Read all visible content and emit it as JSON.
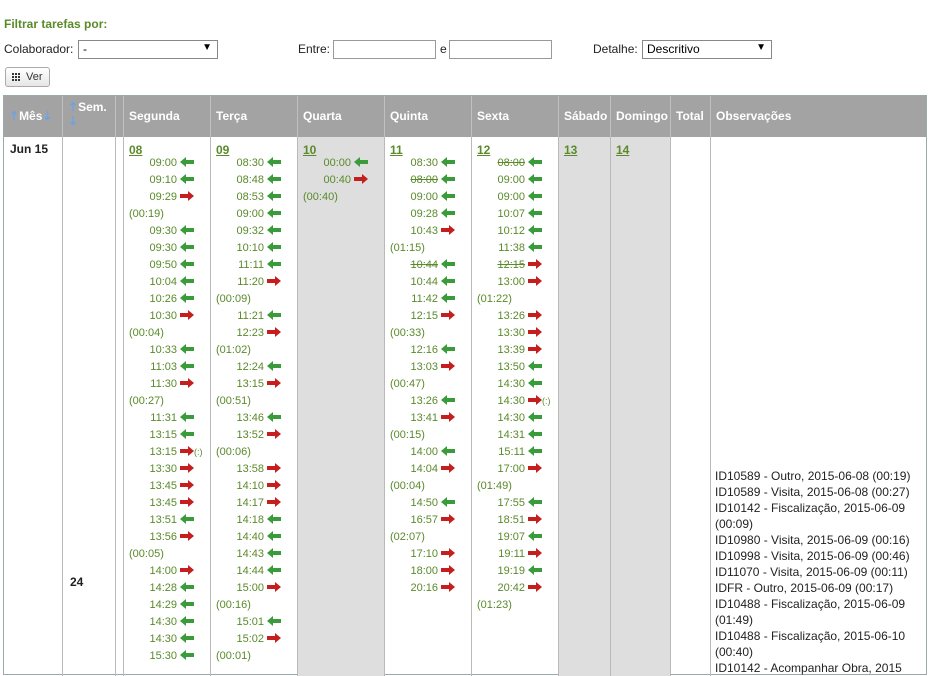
{
  "filter": {
    "title": "Filtrar tarefas por:",
    "colaborador_label": "Colaborador:",
    "colaborador_value": "-",
    "entre_label": "Entre:",
    "e_label": "e",
    "entre_from": "",
    "entre_to": "",
    "detalhe_label": "Detalhe:",
    "detalhe_value": "Descritivo",
    "ver_label": "Ver"
  },
  "table": {
    "headers": {
      "mes": "Mês",
      "sem": "Sem.",
      "seg": "Segunda",
      "ter": "Terça",
      "qua": "Quarta",
      "qui": "Quinta",
      "sex": "Sexta",
      "sab": "Sábado",
      "dom": "Domingo",
      "total": "Total",
      "obs": "Observações"
    },
    "month": "Jun 15",
    "week": "24",
    "days": [
      "08",
      "09",
      "10",
      "11",
      "12",
      "13",
      "14"
    ],
    "segunda": [
      {
        "t": "09:00",
        "d": "in"
      },
      {
        "t": "09:10",
        "d": "in"
      },
      {
        "t": "09:29",
        "d": "out"
      },
      {
        "dur": "(00:19)"
      },
      {
        "t": "09:30",
        "d": "in"
      },
      {
        "t": "09:30",
        "d": "in"
      },
      {
        "t": "09:50",
        "d": "in"
      },
      {
        "t": "10:04",
        "d": "in"
      },
      {
        "t": "10:26",
        "d": "in"
      },
      {
        "t": "10:30",
        "d": "out"
      },
      {
        "dur": "(00:04)"
      },
      {
        "t": "10:33",
        "d": "in"
      },
      {
        "t": "11:03",
        "d": "in"
      },
      {
        "t": "11:30",
        "d": "out"
      },
      {
        "dur": "(00:27)"
      },
      {
        "t": "11:31",
        "d": "in"
      },
      {
        "t": "13:15",
        "d": "in"
      },
      {
        "t": "13:15",
        "d": "out",
        "x": "(:)"
      },
      {
        "t": "13:30",
        "d": "out"
      },
      {
        "t": "13:45",
        "d": "out"
      },
      {
        "t": "13:45",
        "d": "out"
      },
      {
        "t": "13:51",
        "d": "in"
      },
      {
        "t": "13:56",
        "d": "out"
      },
      {
        "dur": "(00:05)"
      },
      {
        "t": "14:00",
        "d": "out"
      },
      {
        "t": "14:28",
        "d": "in"
      },
      {
        "t": "14:29",
        "d": "in"
      },
      {
        "t": "14:30",
        "d": "in"
      },
      {
        "t": "14:30",
        "d": "in"
      },
      {
        "t": "15:30",
        "d": "in"
      }
    ],
    "terca": [
      {
        "t": "08:30",
        "d": "in"
      },
      {
        "t": "08:48",
        "d": "in"
      },
      {
        "t": "08:53",
        "d": "in"
      },
      {
        "t": "09:00",
        "d": "in"
      },
      {
        "t": "09:32",
        "d": "in"
      },
      {
        "t": "10:10",
        "d": "in"
      },
      {
        "t": "11:11",
        "d": "in"
      },
      {
        "t": "11:20",
        "d": "out"
      },
      {
        "dur": "(00:09)"
      },
      {
        "t": "11:21",
        "d": "in"
      },
      {
        "t": "12:23",
        "d": "out"
      },
      {
        "dur": "(01:02)"
      },
      {
        "t": "12:24",
        "d": "in"
      },
      {
        "t": "13:15",
        "d": "out"
      },
      {
        "dur": "(00:51)"
      },
      {
        "t": "13:46",
        "d": "in"
      },
      {
        "t": "13:52",
        "d": "out"
      },
      {
        "dur": "(00:06)"
      },
      {
        "t": "13:58",
        "d": "out"
      },
      {
        "t": "14:10",
        "d": "out"
      },
      {
        "t": "14:17",
        "d": "out"
      },
      {
        "t": "14:18",
        "d": "in"
      },
      {
        "t": "14:40",
        "d": "in"
      },
      {
        "t": "14:43",
        "d": "in"
      },
      {
        "t": "14:44",
        "d": "in"
      },
      {
        "t": "15:00",
        "d": "out"
      },
      {
        "dur": "(00:16)"
      },
      {
        "t": "15:01",
        "d": "in"
      },
      {
        "t": "15:02",
        "d": "out"
      },
      {
        "dur": "(00:01)"
      }
    ],
    "quarta": [
      {
        "t": "00:00",
        "d": "in"
      },
      {
        "t": "00:40",
        "d": "out"
      },
      {
        "dur": "(00:40)"
      }
    ],
    "quinta": [
      {
        "t": "08:30",
        "d": "in"
      },
      {
        "t": "08:00",
        "d": "in",
        "s": true
      },
      {
        "t": "09:00",
        "d": "in"
      },
      {
        "t": "09:28",
        "d": "in"
      },
      {
        "t": "10:43",
        "d": "out"
      },
      {
        "dur": "(01:15)"
      },
      {
        "t": "10:44",
        "d": "in",
        "s": true
      },
      {
        "t": "10:44",
        "d": "in"
      },
      {
        "t": "11:42",
        "d": "in"
      },
      {
        "t": "12:15",
        "d": "out"
      },
      {
        "dur": "(00:33)"
      },
      {
        "t": "12:16",
        "d": "in"
      },
      {
        "t": "13:03",
        "d": "out"
      },
      {
        "dur": "(00:47)"
      },
      {
        "t": "13:26",
        "d": "in"
      },
      {
        "t": "13:41",
        "d": "out"
      },
      {
        "dur": "(00:15)"
      },
      {
        "t": "14:00",
        "d": "in"
      },
      {
        "t": "14:04",
        "d": "out"
      },
      {
        "dur": "(00:04)"
      },
      {
        "t": "14:50",
        "d": "in"
      },
      {
        "t": "16:57",
        "d": "out"
      },
      {
        "dur": "(02:07)"
      },
      {
        "t": "17:10",
        "d": "out"
      },
      {
        "t": "18:00",
        "d": "out"
      },
      {
        "t": "20:16",
        "d": "out"
      }
    ],
    "sexta": [
      {
        "t": "08:00",
        "d": "in",
        "s": true
      },
      {
        "t": "09:00",
        "d": "in"
      },
      {
        "t": "09:00",
        "d": "in"
      },
      {
        "t": "10:07",
        "d": "in"
      },
      {
        "t": "10:12",
        "d": "in"
      },
      {
        "t": "11:38",
        "d": "in"
      },
      {
        "t": "12:15",
        "d": "out",
        "s": true
      },
      {
        "t": "13:00",
        "d": "out"
      },
      {
        "dur": "(01:22)"
      },
      {
        "t": "13:26",
        "d": "out"
      },
      {
        "t": "13:30",
        "d": "out"
      },
      {
        "t": "13:39",
        "d": "out"
      },
      {
        "t": "13:50",
        "d": "in"
      },
      {
        "t": "14:30",
        "d": "in"
      },
      {
        "t": "14:30",
        "d": "out",
        "x": "(:)"
      },
      {
        "t": "14:30",
        "d": "in"
      },
      {
        "t": "14:31",
        "d": "in"
      },
      {
        "t": "15:11",
        "d": "in"
      },
      {
        "t": "17:00",
        "d": "out"
      },
      {
        "dur": "(01:49)"
      },
      {
        "t": "17:55",
        "d": "in"
      },
      {
        "t": "18:51",
        "d": "out"
      },
      {
        "t": "19:07",
        "d": "in"
      },
      {
        "t": "19:11",
        "d": "out"
      },
      {
        "t": "19:19",
        "d": "in"
      },
      {
        "t": "20:42",
        "d": "out"
      },
      {
        "dur": "(01:23)"
      }
    ],
    "observacoes": [
      "ID10589 - Outro, 2015-06-08 (00:19)",
      "ID10589 - Visita, 2015-06-08 (00:27)",
      "ID10142 - Fiscalização, 2015-06-09 (00:09)",
      "ID10980 - Visita, 2015-06-09 (00:16)",
      "ID10998 - Visita, 2015-06-09 (00:46)",
      "ID11070 - Visita, 2015-06-09 (00:11)",
      "IDFR - Outro, 2015-06-09 (00:17)",
      "ID10488 - Fiscalização, 2015-06-09 (01:49)",
      "ID10488 - Fiscalização, 2015-06-10 (00:40)",
      "ID10142 - Acompanhar Obra, 2015"
    ]
  }
}
